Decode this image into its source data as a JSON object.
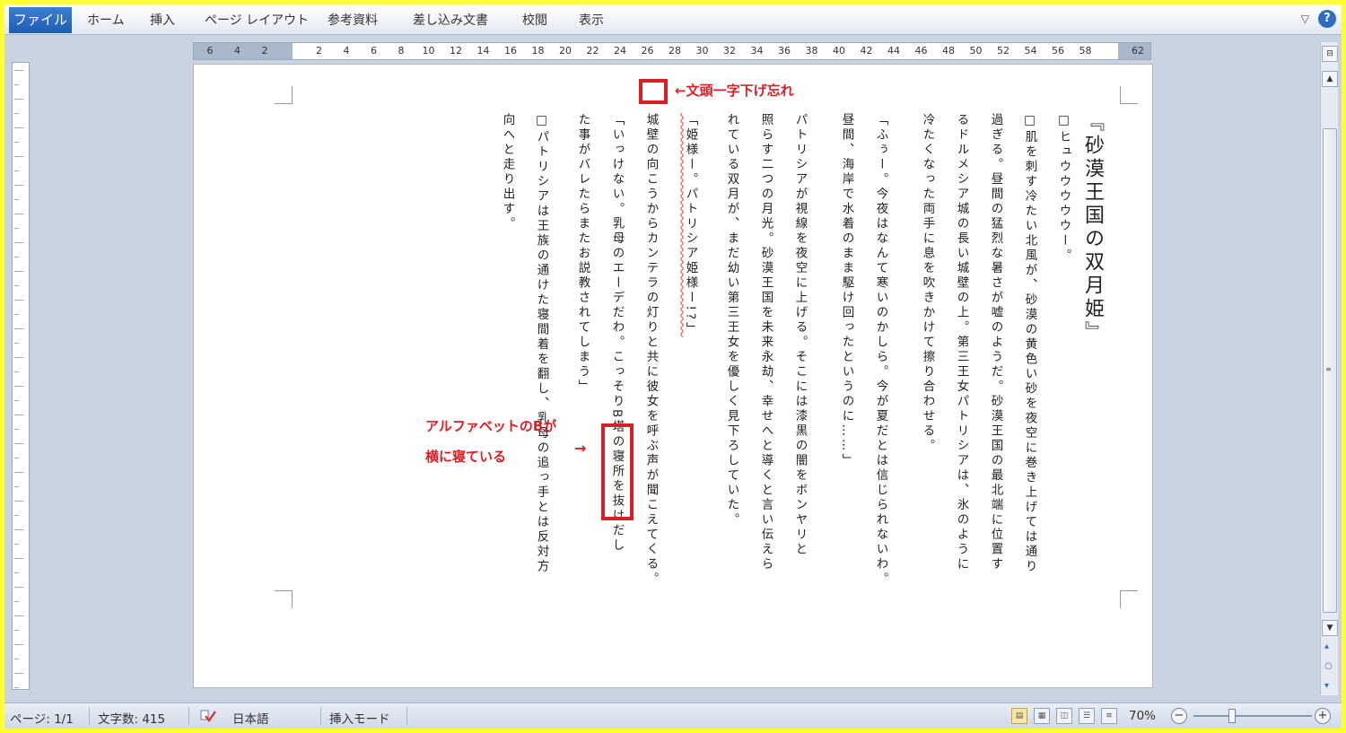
{
  "ribbon": {
    "tabs": [
      "ファイル",
      "ホーム",
      "挿入",
      "ページ レイアウト",
      "参考資料",
      "差し込み文書",
      "校閲",
      "表示"
    ],
    "minimize_icon": "chevron-down-icon",
    "help_label": "?"
  },
  "ruler": {
    "labels": [
      "6",
      "4",
      "2",
      "2",
      "4",
      "6",
      "8",
      "10",
      "12",
      "14",
      "16",
      "18",
      "20",
      "22",
      "24",
      "26",
      "28",
      "30",
      "32",
      "34",
      "36",
      "38",
      "40",
      "42",
      "44",
      "46",
      "48",
      "50",
      "52",
      "54",
      "56",
      "58",
      "62"
    ]
  },
  "document": {
    "title": "『砂漠王国の双月姫』",
    "lines": [
      "□ヒュウウウウウー。",
      "□肌を刺す冷たい北風が、砂漠の黄色い砂を夜空に巻き上げては通り",
      "過ぎる。昼間の猛烈な暑さが嘘のようだ。砂漠王国の最北端に位置す",
      "るドルメシア城の長い城壁の上。第三王女パトリシアは、氷のように",
      "冷たくなった両手に息を吹きかけて擦り合わせる。",
      "「ふぅー。今夜はなんて寒いのかしら。今が夏だとは信じられないわ。",
      "昼間、海岸で水着のまま駆け回ったというのに……」",
      "パトリシアが視線を夜空に上げる。そこには漆黒の闇をボンヤリと",
      "照らす二つの月光。砂漠王国を未来永劫、幸せへと導くと言い伝えら",
      "れている双月が、まだ幼い第三王女を優しく見下ろしていた。",
      "「姫様ー。パトリシア姫様ー!?」",
      "城壁の向こうからカンテラの灯りと共に彼女を呼ぶ声が聞こえてくる。",
      "「いっけない。乳母のエーデだわ。こっそりB塔の寝所を抜けだし",
      "た事がバレたらまたお説教されてしまう」",
      "□パトリシアは王族の通けた寝間着を翻し、乳母の追っ手とは反対方",
      "向へと走り出す。"
    ]
  },
  "annotations": {
    "note1": "←文頭一字下げ忘れ",
    "note2_line1": "アルファベットのBが",
    "note2_line2": "横に寝ている",
    "note2_arrow": "→"
  },
  "status": {
    "page": "ページ: 1/1",
    "word_count": "文字数: 415",
    "language": "日本語",
    "mode": "挿入モード",
    "zoom": "70%",
    "zoom_value": 70
  },
  "colors": {
    "frame_border": "#ffff33",
    "annotation": "#d81f26",
    "file_tab": "#2563b6"
  }
}
